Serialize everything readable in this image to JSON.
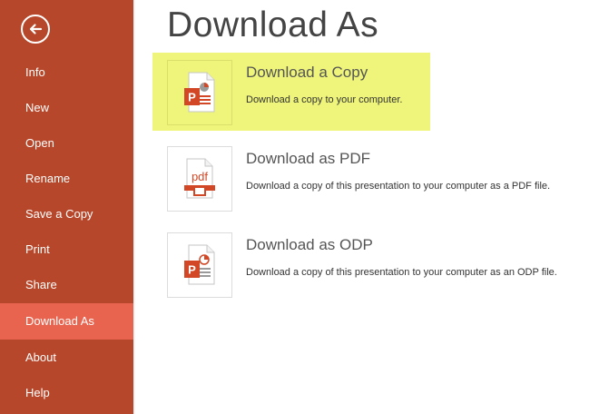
{
  "sidebar": {
    "back_icon": "back-arrow-icon",
    "items": [
      {
        "label": "Info"
      },
      {
        "label": "New"
      },
      {
        "label": "Open"
      },
      {
        "label": "Rename"
      },
      {
        "label": "Save a Copy"
      },
      {
        "label": "Print"
      },
      {
        "label": "Share"
      },
      {
        "label": "Download As",
        "active": true
      },
      {
        "label": "About"
      },
      {
        "label": "Help"
      }
    ]
  },
  "main": {
    "title": "Download As",
    "options": [
      {
        "title": "Download a Copy",
        "description": "Download a copy to your computer.",
        "icon": "pptx-file-icon",
        "highlighted": true
      },
      {
        "title": "Download as PDF",
        "description": "Download a copy of this presentation to your computer as a PDF file.",
        "icon": "pdf-file-icon",
        "icon_text": "pdf"
      },
      {
        "title": "Download as ODP",
        "description": "Download a copy of this presentation to your computer as an ODP file.",
        "icon": "odp-file-icon"
      }
    ]
  },
  "colors": {
    "sidebar_bg": "#b7472a",
    "active_item_bg": "#e9644e",
    "highlight": "#eef57a",
    "accent_orange": "#d24726"
  }
}
